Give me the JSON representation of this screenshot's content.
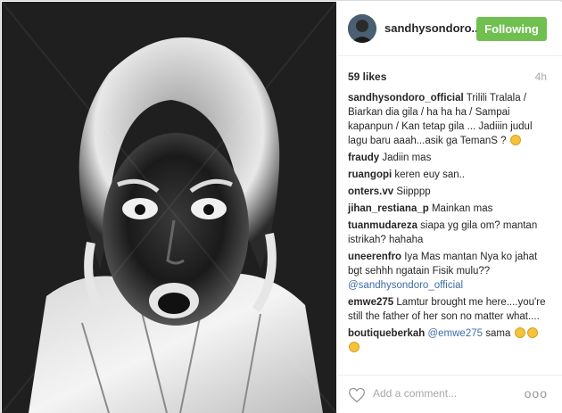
{
  "post": {
    "author": "sandhysondoro...",
    "follow_label": "Following",
    "likes": "59 likes",
    "time": "4h",
    "add_comment_placeholder": "Add a comment...",
    "more_label": "ooo"
  },
  "comments": [
    {
      "user": "sandhysondoro_official",
      "text": "Trilili Tralala / Biarkan dia gila / ha ha ha / Sampai kapanpun / Kan tetap gila ... Jadiiin judul lagu baru aaah...asik ga TemanS ?"
    },
    {
      "user": "fraudy",
      "text": "Jadiin mas"
    },
    {
      "user": "ruangopi",
      "text": "keren euy san.."
    },
    {
      "user": "onters.vv",
      "text": "Siipppp"
    },
    {
      "user": "jihan_restiana_p",
      "text": "Mainkan mas"
    },
    {
      "user": "tuanmudareza",
      "text": "siapa yg gila om? mantan istrikah? hahaha"
    },
    {
      "user": "uneerenfro",
      "text": "Iya Mas mantan Nya ko jahat bgt sehhh ngatain Fisik mulu??",
      "mention": "@sandhysondoro_official"
    },
    {
      "user": "emwe275",
      "text": "Lamtur brought me here....you're still the father of her son no matter what...."
    },
    {
      "user": "boutiqueberkah",
      "mention": "@emwe275",
      "text": "sama"
    }
  ],
  "icons": {
    "heart": "heart-icon",
    "more": "more-options-icon",
    "emoji": "emoji-icon"
  },
  "colors": {
    "follow_button": "#70c050",
    "mention": "#3d6ea6",
    "muted": "#a5a7aa"
  }
}
